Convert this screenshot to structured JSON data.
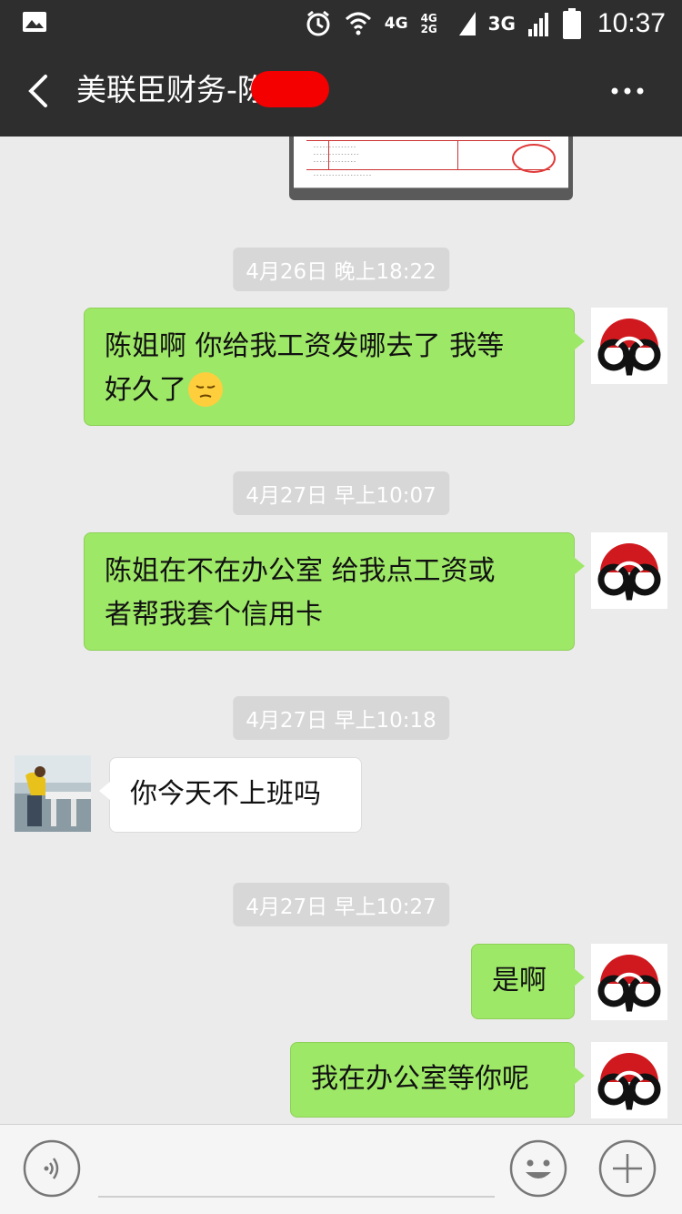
{
  "status_bar": {
    "network_1": "4G",
    "network_2": "4G 2G",
    "network_3": "3G",
    "time": "10:37"
  },
  "header": {
    "title": "美联臣财务-陈",
    "back_icon": "chevron-left-icon",
    "more_icon": "more-icon"
  },
  "messages": [
    {
      "type": "timestamp",
      "text": "4月26日 晚上18:22"
    },
    {
      "type": "outgoing",
      "lines": [
        "陈姐啊  你给我工资发哪去了  我等",
        "好久了"
      ],
      "emoji": "pensive-face"
    },
    {
      "type": "timestamp",
      "text": "4月27日 早上10:07"
    },
    {
      "type": "outgoing",
      "lines": [
        "陈姐在不在办公室   给我点工资或",
        "者帮我套个信用卡"
      ]
    },
    {
      "type": "timestamp",
      "text": "4月27日 早上10:18"
    },
    {
      "type": "incoming",
      "lines": [
        "你今天不上班吗"
      ]
    },
    {
      "type": "timestamp",
      "text": "4月27日 早上10:27"
    },
    {
      "type": "outgoing",
      "lines": [
        "是啊"
      ]
    },
    {
      "type": "outgoing",
      "lines": [
        "我在办公室等你呢"
      ]
    }
  ],
  "colors": {
    "outgoing_bubble": "#9ee867",
    "incoming_bubble": "#ffffff",
    "bar": "#2e2e2e",
    "redaction": "#f40000"
  }
}
